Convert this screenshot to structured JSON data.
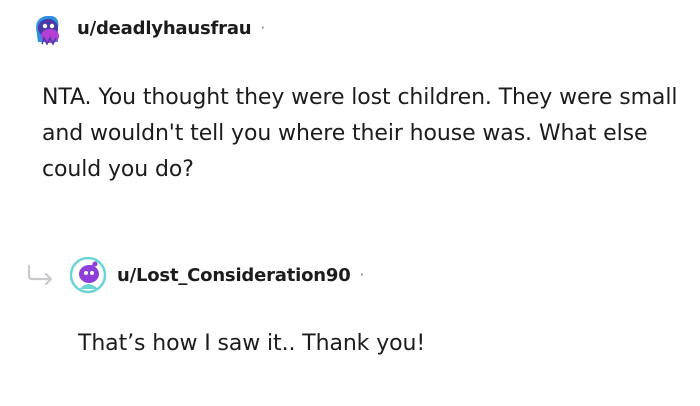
{
  "comments": [
    {
      "username": "u/deadlyhausfrau",
      "separator": "·",
      "body": "NTA. You thought they were lost children. They were small and wouldn't tell you where their house was. What else could you do?",
      "avatar_icon": "snoo-avatar-icon",
      "avatar_colors": {
        "primary": "#4a3aa8",
        "secondary": "#b43fd6",
        "accent": "#2f8fe0"
      }
    },
    {
      "username": "u/Lost_Consideration90",
      "separator": "·",
      "body": "That’s how I saw it.. Thank you!",
      "avatar_icon": "snoo-avatar-icon",
      "avatar_colors": {
        "primary": "#8e3fd8",
        "secondary": "#6ad4d4",
        "accent": "#e8e0f0"
      },
      "reply_icon": "reply-arrow-icon"
    }
  ],
  "colors": {
    "text": "#1c1c1c",
    "meta": "#7c7c7c",
    "reply_arrow": "#c8cbcd"
  }
}
